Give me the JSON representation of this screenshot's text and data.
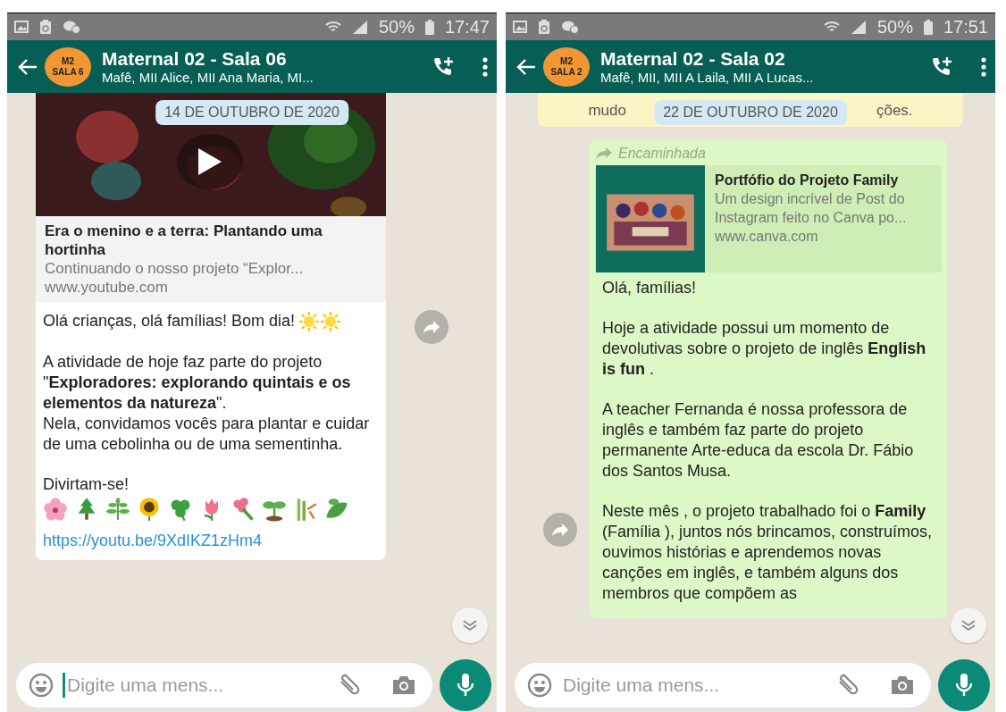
{
  "panels": [
    {
      "status_bar": {
        "battery": "50%",
        "time": "17:47"
      },
      "header": {
        "avatar_lines": [
          "M2",
          "SALA 6"
        ],
        "title": "Maternal 02 - Sala 06",
        "subtitle": "Mafê, MII Alice, MII Ana Maria, MI..."
      },
      "date_chip": "14 DE OUTUBRO DE 2020",
      "message": {
        "outgoing": false,
        "preview": {
          "kind": "video",
          "title": "Era o menino e a terra: Plantando uma hortinha",
          "description": "Continuando o nosso projeto “Explor...",
          "url": "www.youtube.com"
        },
        "paragraphs": [
          {
            "text": "Olá crianças, olá famílias! Bom dia!",
            "suns": true
          },
          {
            "text": "A atividade de hoje faz parte do projeto \"**Exploradores: explorando quintais e os elementos da natureza**\".\nNela, convidamos vocês para plantar e cuidar de uma cebolinha ou de uma sementinha."
          },
          {
            "text": "Divirtam-se!",
            "plants": true
          }
        ],
        "link": "https://youtu.be/9XdIKZ1zHm4"
      },
      "input": {
        "placeholder": "Digite uma mens...",
        "focused": true
      }
    },
    {
      "status_bar": {
        "battery": "50%",
        "time": "17:51"
      },
      "header": {
        "avatar_lines": [
          "M2",
          "SALA 2"
        ],
        "title": "Maternal 02 - Sala 02",
        "subtitle": "Mafê, MII, MII A Laila, MII A Lucas..."
      },
      "notice": {
        "text_before": "mudo",
        "text_after": "ções."
      },
      "date_chip": "22 DE OUTUBRO DE 2020",
      "message": {
        "outgoing": true,
        "forwarded_label": "Encaminhada",
        "preview": {
          "kind": "thumbnail",
          "title": "Portfófio do Projeto Family",
          "description": "Um design incrível de Post do Instagram feito no Canva po...",
          "url": "www.canva.com"
        },
        "paragraphs": [
          {
            "text": "Olá, famílias!"
          },
          {
            "text": "Hoje a atividade possui  um momento de devolutivas sobre o projeto de inglês **English is fun** ."
          },
          {
            "text": "A teacher Fernanda é nossa professora de inglês e também faz parte do projeto permanente Arte-educa da escola Dr. Fábio dos Santos Musa."
          },
          {
            "text": "Neste mês , o projeto trabalhado foi o **Family** (Família ), juntos nós brincamos, construímos, ouvimos histórias e aprendemos novas canções em inglês, e também alguns dos membros que compõem as"
          }
        ]
      },
      "input": {
        "placeholder": "Digite uma mens...",
        "focused": false
      }
    }
  ]
}
